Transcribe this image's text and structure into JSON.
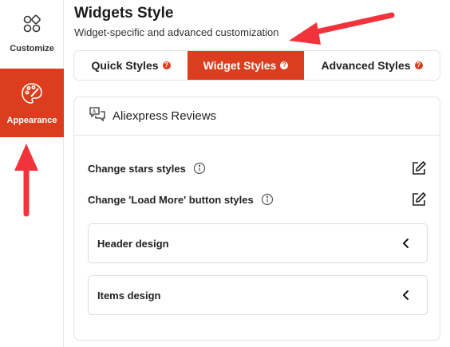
{
  "sidebar": {
    "items": [
      {
        "label": "Customize",
        "icon": "grid-apps-icon",
        "active": false
      },
      {
        "label": "Appearance",
        "icon": "palette-icon",
        "active": true
      }
    ]
  },
  "header": {
    "title": "Widgets Style",
    "subtitle": "Widget-specific and advanced customization"
  },
  "tabs": [
    {
      "label": "Quick Styles",
      "active": false
    },
    {
      "label": "Widget Styles",
      "active": true
    },
    {
      "label": "Advanced Styles",
      "active": false
    }
  ],
  "panel": {
    "title": "Aliexpress Reviews",
    "rows": [
      {
        "label": "Change stars styles"
      },
      {
        "label": "Change 'Load More' button styles"
      }
    ],
    "accordions": [
      {
        "label": "Header design"
      },
      {
        "label": "Items design"
      }
    ]
  },
  "colors": {
    "accent": "#dc3d1e",
    "annotation_arrow": "#f2333b"
  }
}
